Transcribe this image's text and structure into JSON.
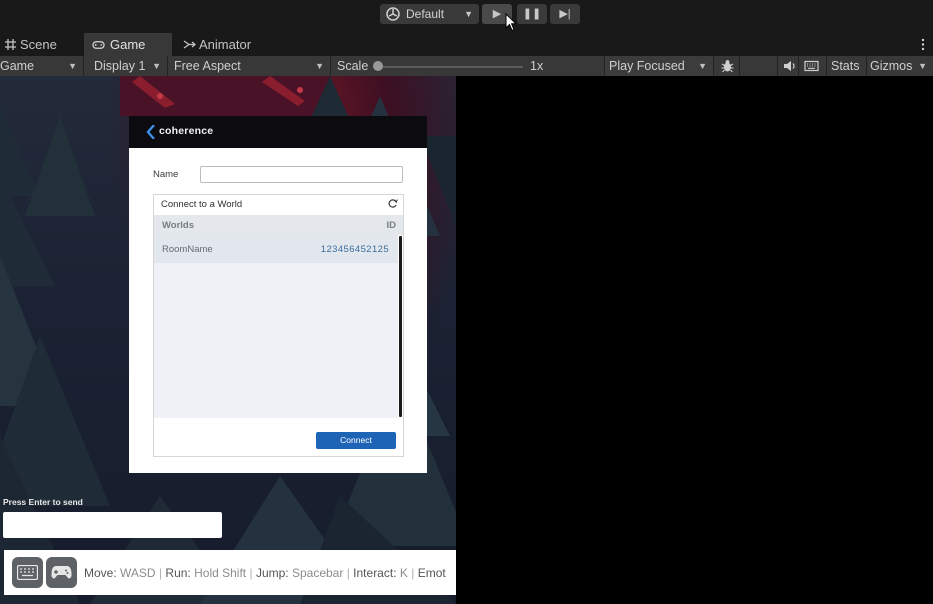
{
  "toolbar": {
    "layout_label": "Default",
    "play_icon": "play-icon",
    "pause_icon": "pause-icon",
    "step_icon": "step-icon"
  },
  "tabs": [
    {
      "label": "Scene",
      "icon": "grid-icon"
    },
    {
      "label": "Game",
      "icon": "gamepad-icon",
      "active": true
    },
    {
      "label": "Animator",
      "icon": "animator-icon"
    }
  ],
  "game_toolbar": {
    "mode": "Game",
    "display": "Display 1",
    "aspect": "Free Aspect",
    "scale_label": "Scale",
    "scale_value": "1x",
    "play_mode": "Play Focused",
    "stats": "Stats",
    "gizmos": "Gizmos"
  },
  "panel": {
    "brand": "coherence",
    "name_label": "Name",
    "name_value": "",
    "connect_title": "Connect to a World",
    "col_worlds": "Worlds",
    "col_id": "ID",
    "rows": [
      {
        "name": "RoomName",
        "id": "123456452125"
      }
    ],
    "connect_button": "Connect"
  },
  "chat": {
    "label": "Press Enter to send",
    "value": ""
  },
  "hints": [
    {
      "key": "Move:",
      "value": "WASD"
    },
    {
      "key": "Run:",
      "value": "Hold Shift"
    },
    {
      "key": "Jump:",
      "value": "Spacebar"
    },
    {
      "key": "Interact:",
      "value": "K"
    },
    {
      "key": "Emot",
      "value": ""
    }
  ],
  "colors": {
    "editor_bg": "#191919",
    "toolbar_bg": "#383838",
    "accent_button": "#1e64b6",
    "id_text": "#3c6e9e"
  }
}
